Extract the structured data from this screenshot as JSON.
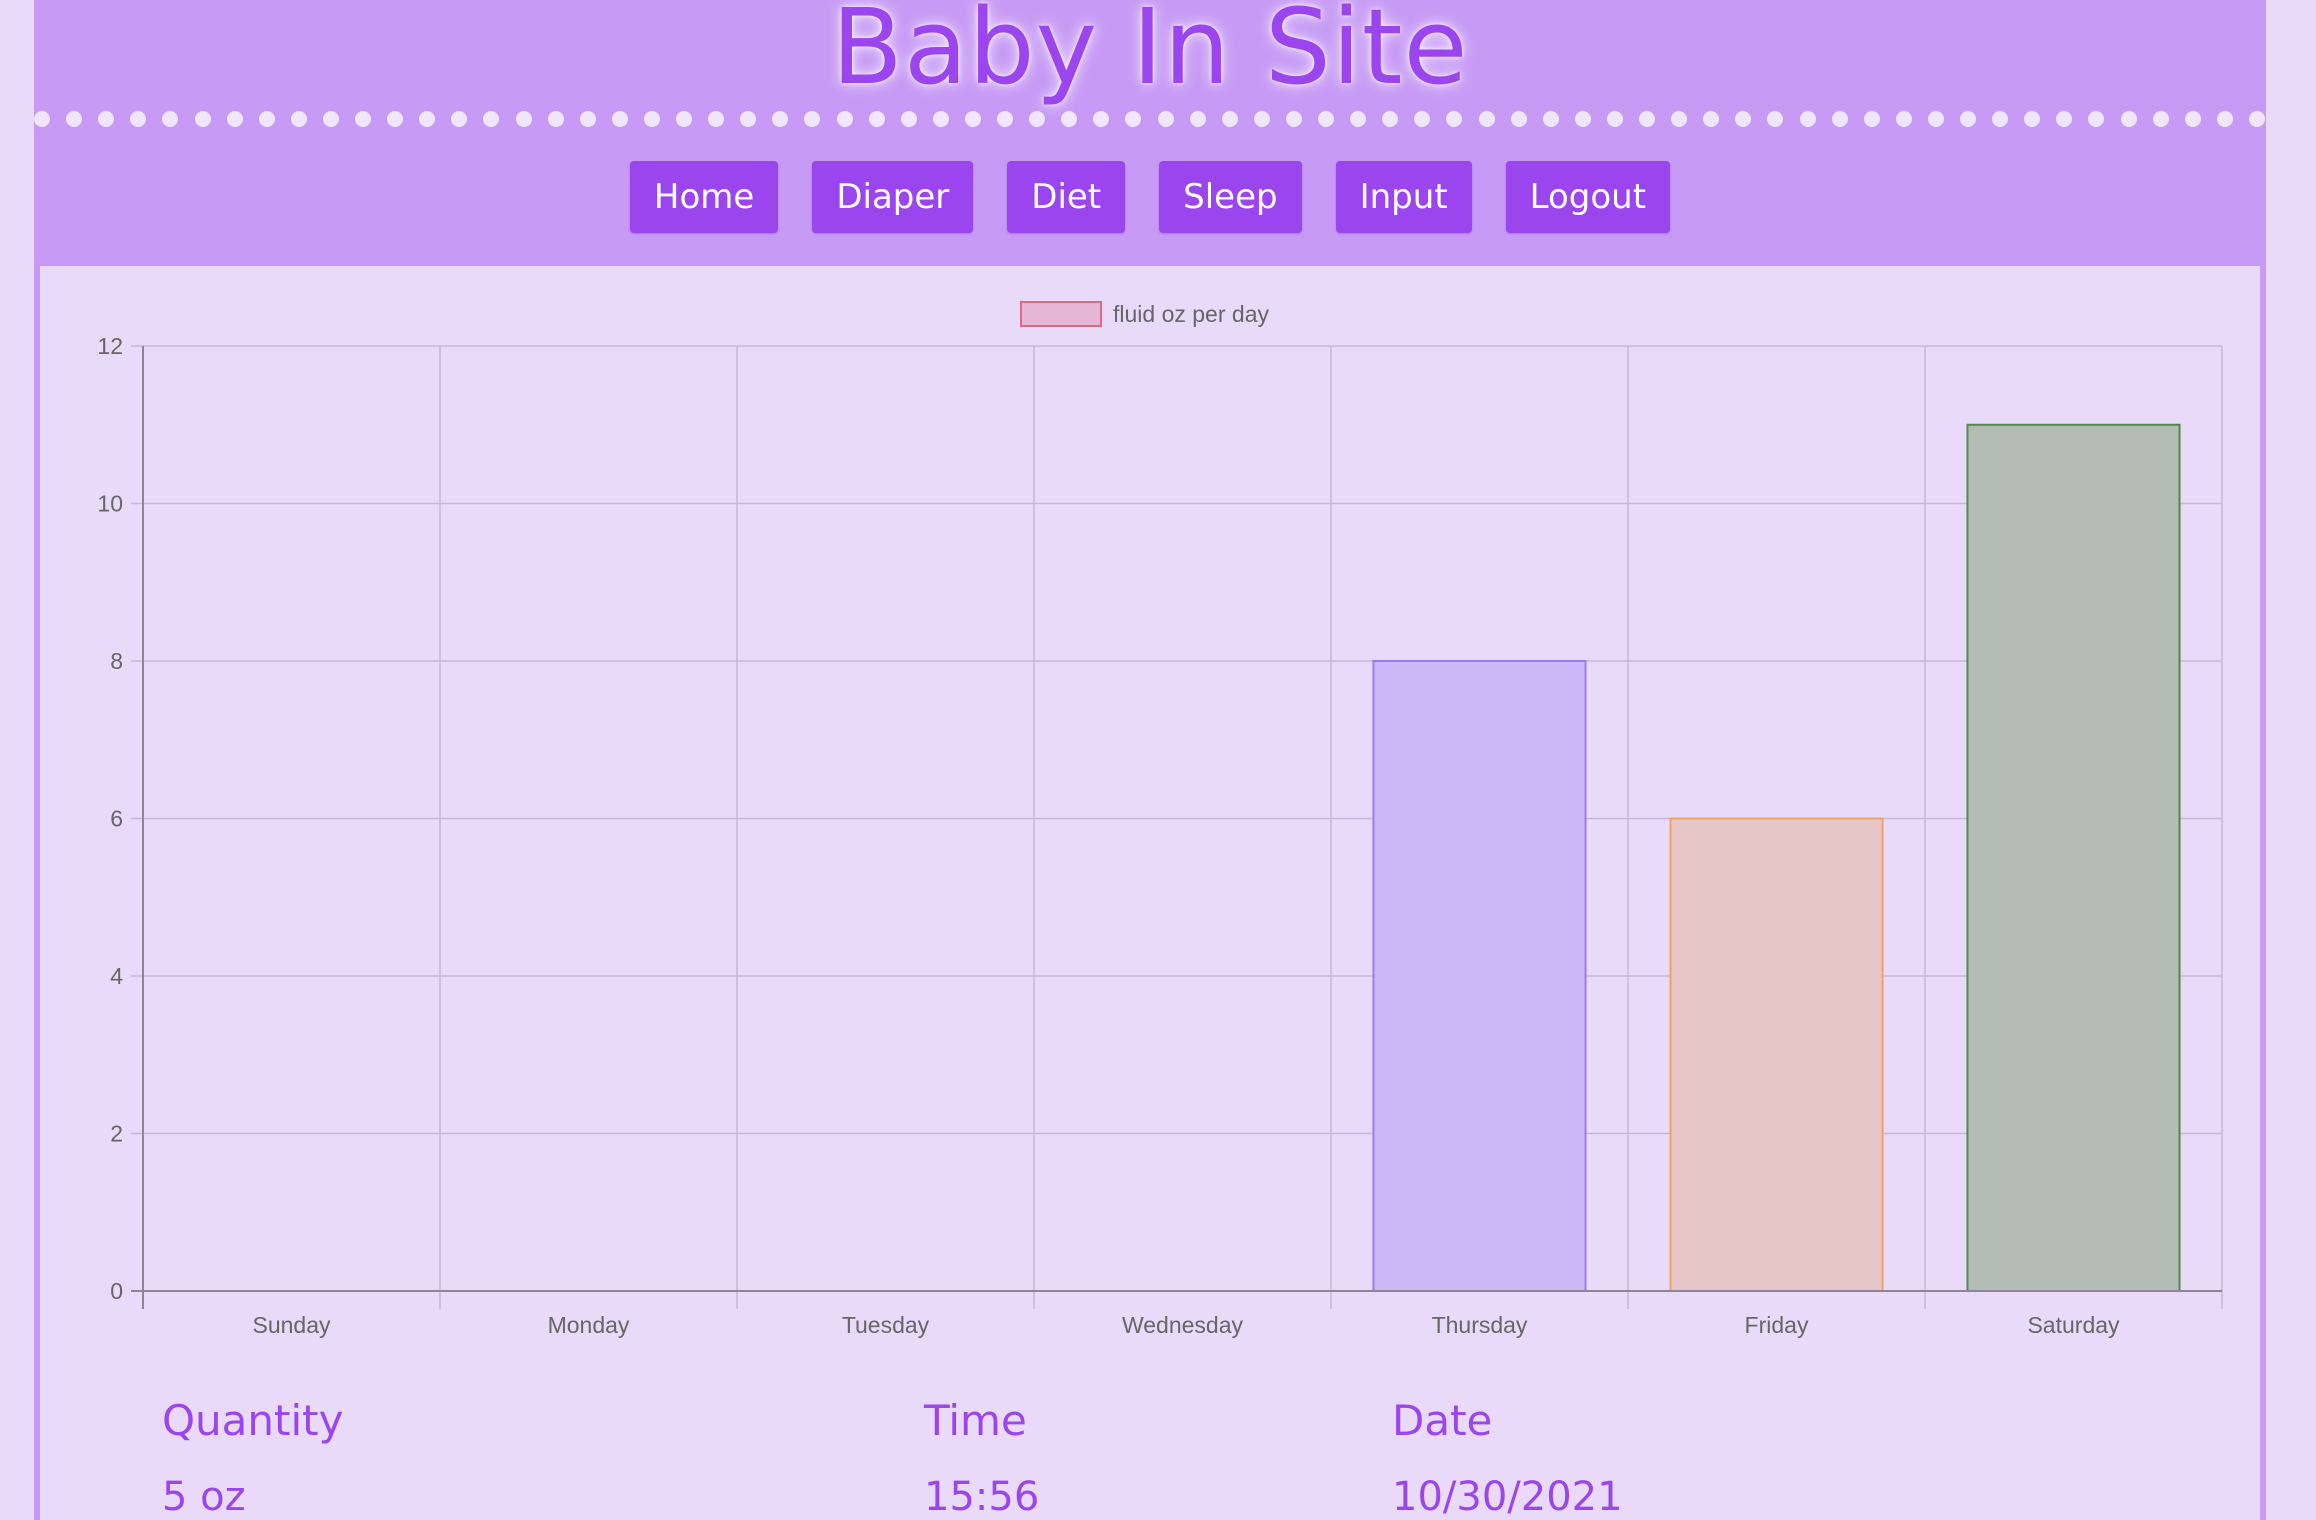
{
  "header": {
    "title": "Baby In Site"
  },
  "nav": {
    "items": [
      {
        "label": "Home"
      },
      {
        "label": "Diaper"
      },
      {
        "label": "Diet"
      },
      {
        "label": "Sleep"
      },
      {
        "label": "Input"
      },
      {
        "label": "Logout"
      }
    ]
  },
  "colors": {
    "brand": "#9b45ee",
    "header_bg": "#c79bf5",
    "page_bg": "#e9daf9"
  },
  "chart_data": {
    "type": "bar",
    "categories": [
      "Sunday",
      "Monday",
      "Tuesday",
      "Wednesday",
      "Thursday",
      "Friday",
      "Saturday"
    ],
    "series": [
      {
        "name": "fluid oz per day",
        "values": [
          0,
          0,
          0,
          0,
          8,
          6,
          11
        ]
      }
    ],
    "bar_colors": [
      "#e6b6d6",
      "#e6b6d6",
      "#e6b6d6",
      "#e6b6d6",
      "#cdb8f6",
      "#e8c6c7",
      "#b3bdb6"
    ],
    "bar_border_colors": [
      "#e0697f",
      "#e0697f",
      "#e0697f",
      "#e0697f",
      "#9b7af0",
      "#eda265",
      "#4e8a4a"
    ],
    "legend_swatch": {
      "fill": "#e6b6d6",
      "border": "#e0697f"
    },
    "ylim": [
      0,
      12
    ],
    "yticks": [
      "0",
      "2",
      "4",
      "6",
      "8",
      "10",
      "12"
    ],
    "grid": true,
    "legend_position": "top"
  },
  "table": {
    "headers": {
      "quantity": "Quantity",
      "time": "Time",
      "date": "Date"
    },
    "rows": [
      {
        "quantity": "5 oz",
        "time": "15:56",
        "date": "10/30/2021"
      }
    ]
  }
}
